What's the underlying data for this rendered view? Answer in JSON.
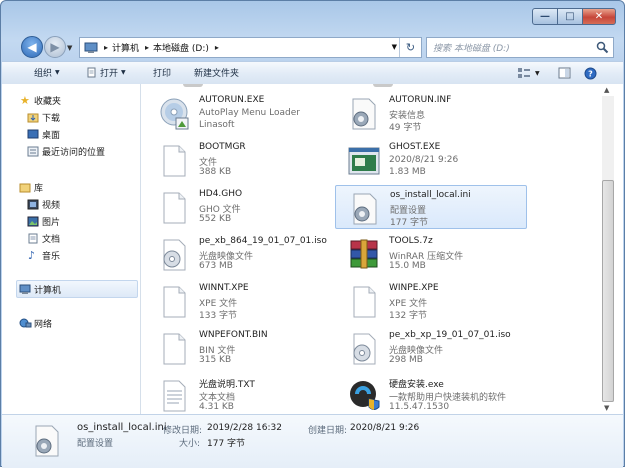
{
  "window": {
    "minimize_glyph": "—",
    "maximize_glyph": "□",
    "close_glyph": "✕"
  },
  "address": {
    "segments": [
      "计算机",
      "本地磁盘 (D:)"
    ],
    "search_placeholder": "搜索 本地磁盘 (D:)"
  },
  "toolbar": {
    "organize": "组织",
    "open": "打开",
    "print": "打印",
    "new_folder": "新建文件夹"
  },
  "nav": {
    "favorites": "收藏夹",
    "downloads": "下载",
    "desktop": "桌面",
    "recent": "最近访问的位置",
    "libraries": "库",
    "videos": "视频",
    "pictures": "图片",
    "documents": "文档",
    "music": "音乐",
    "computer": "计算机",
    "network": "网络"
  },
  "files": [
    {
      "name": "AUTORUN.EXE",
      "type": "AutoPlay Menu Loader",
      "size": "Linasoft",
      "icon": "autoplay-cd-icon"
    },
    {
      "name": "AUTORUN.INF",
      "type": "安装信息",
      "size": "49 字节",
      "icon": "settings-file-icon"
    },
    {
      "name": "BOOTMGR",
      "type": "文件",
      "size": "388 KB",
      "icon": "blank-file-icon"
    },
    {
      "name": "GHOST.EXE",
      "type": "2020/8/21 9:26",
      "size": "1.83 MB",
      "icon": "ghost-exe-icon"
    },
    {
      "name": "HD4.GHO",
      "type": "GHO 文件",
      "size": "552 KB",
      "icon": "blank-file-icon"
    },
    {
      "name": "os_install_local.ini",
      "type": "配置设置",
      "size": "177 字节",
      "icon": "settings-file-icon"
    },
    {
      "name": "pe_xb_864_19_01_07_01.iso",
      "type": "光盘映像文件",
      "size": "673 MB",
      "icon": "disc-image-icon"
    },
    {
      "name": "TOOLS.7z",
      "type": "WinRAR 压缩文件",
      "size": "15.0 MB",
      "icon": "winrar-archive-icon"
    },
    {
      "name": "WINNT.XPE",
      "type": "XPE 文件",
      "size": "133 字节",
      "icon": "blank-file-icon"
    },
    {
      "name": "WINPE.XPE",
      "type": "XPE 文件",
      "size": "132 字节",
      "icon": "blank-file-icon"
    },
    {
      "name": "WNPEFONT.BIN",
      "type": "BIN 文件",
      "size": "315 KB",
      "icon": "blank-file-icon"
    },
    {
      "name": "pe_xb_xp_19_01_07_01.iso",
      "type": "光盘映像文件",
      "size": "298 MB",
      "icon": "disc-image-icon"
    },
    {
      "name": "光盘说明.TXT",
      "type": "文本文档",
      "size": "4.31 KB",
      "icon": "text-file-icon"
    },
    {
      "name": "硬盘安装.exe",
      "type": "一款帮助用户快速装机的软件",
      "size": "11.5.47.1530",
      "icon": "installer-shield-icon"
    }
  ],
  "status": {
    "filename": "os_install_local.ini",
    "type": "配置设置",
    "modified_label": "修改日期:",
    "modified_value": "2019/2/28 16:32",
    "size_label": "大小:",
    "size_value": "177 字节",
    "created_label": "创建日期:",
    "created_value": "2020/8/21 9:26"
  }
}
